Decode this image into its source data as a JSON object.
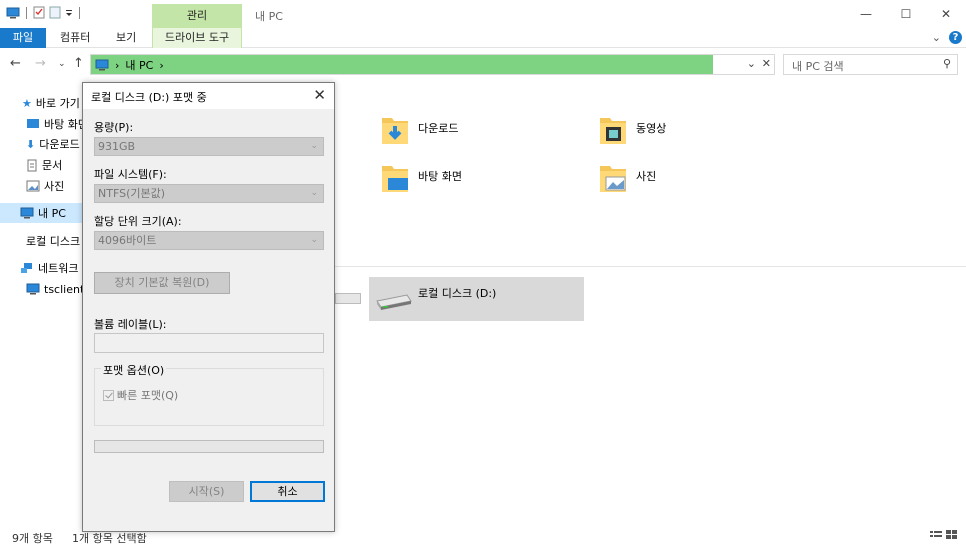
{
  "window": {
    "title": "내 PC",
    "context_tab_group": "관리",
    "minimize": "—",
    "maximize": "☐",
    "close": "✕"
  },
  "ribbon": {
    "tabs": [
      {
        "label": "파일"
      },
      {
        "label": "컴퓨터"
      },
      {
        "label": "보기"
      },
      {
        "label": "드라이브 도구"
      }
    ],
    "expand": "⌄",
    "help": "?"
  },
  "address_bar": {
    "crumbs": [
      "내 PC"
    ],
    "separator": "›",
    "search_placeholder": "내 PC 검색",
    "fill_fraction": 0.91
  },
  "nav_pane": {
    "items": [
      {
        "label": "바로 가기"
      },
      {
        "label": "바탕 화면"
      },
      {
        "label": "다운로드"
      },
      {
        "label": "문서"
      },
      {
        "label": "사진"
      },
      {
        "label": "내 PC"
      },
      {
        "label": "로컬 디스크 (D:)"
      },
      {
        "label": "네트워크"
      },
      {
        "label": "tsclient"
      }
    ]
  },
  "content": {
    "folders": [
      {
        "label": "다운로드"
      },
      {
        "label": "동영상"
      },
      {
        "label": "바탕 화면"
      },
      {
        "label": "사진"
      }
    ],
    "drive": {
      "label": "로컬 디스크 (D:)"
    }
  },
  "status_bar": {
    "item_count": "9개 항목",
    "selected": "1개 항목 선택함"
  },
  "dialog": {
    "title": "로컬 디스크 (D:) 포맷 중",
    "close": "✕",
    "capacity_label": "용량(P):",
    "capacity_value": "931GB",
    "fs_label": "파일 시스템(F):",
    "fs_value": "NTFS(기본값)",
    "alloc_label": "할당 단위 크기(A):",
    "alloc_value": "4096바이트",
    "restore_button": "장치 기본값 복원(D)",
    "volume_label": "볼륨 레이블(L):",
    "volume_value": "",
    "options_label": "포맷 옵션(O)",
    "quick_format": "빠른 포맷(Q)",
    "quick_format_checked": true,
    "progress_fraction": 0.0,
    "start_button": "시작(S)",
    "cancel_button": "취소"
  }
}
